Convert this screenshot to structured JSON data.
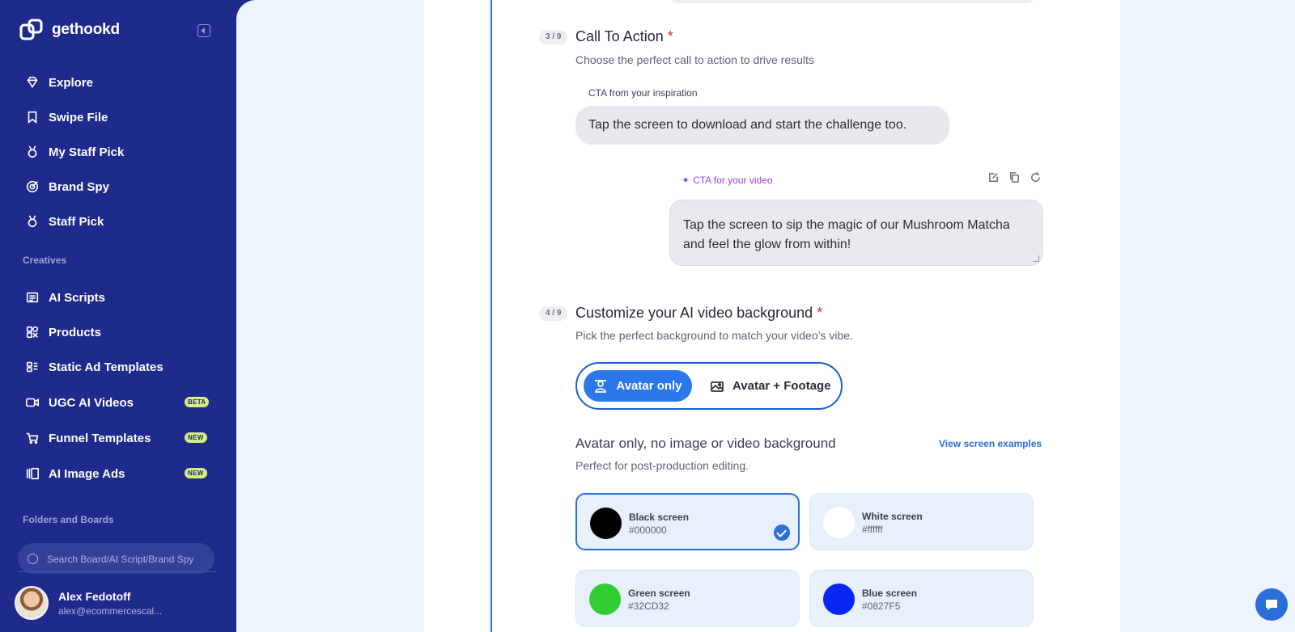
{
  "app": {
    "name": "gethookd"
  },
  "sidebar": {
    "nav_main": [
      {
        "label": "Explore",
        "icon": "diamond-icon"
      },
      {
        "label": "Swipe File",
        "icon": "bookmark-icon"
      },
      {
        "label": "My Staff Pick",
        "icon": "medal-icon"
      },
      {
        "label": "Brand Spy",
        "icon": "target-icon"
      },
      {
        "label": "Staff Pick",
        "icon": "medal-icon"
      }
    ],
    "section_creatives": "Creatives",
    "nav_creatives": [
      {
        "label": "AI Scripts",
        "icon": "script-icon"
      },
      {
        "label": "Products",
        "icon": "products-icon"
      },
      {
        "label": "Static Ad Templates",
        "icon": "template-icon"
      },
      {
        "label": "UGC AI Videos",
        "icon": "video-icon",
        "badge": "BETA"
      },
      {
        "label": "Funnel Templates",
        "icon": "cart-icon",
        "badge": "NEW"
      },
      {
        "label": "AI Image Ads",
        "icon": "gallery-icon",
        "badge": "NEW"
      }
    ],
    "section_folders": "Folders and Boards",
    "search_placeholder": "Search Board/AI Script/Brand Spy",
    "user": {
      "name": "Alex Fedotoff",
      "email": "alex@ecommercescal..."
    }
  },
  "form": {
    "step3": {
      "badge": "3 / 9",
      "title": "Call To Action",
      "required": "*",
      "subtitle": "Choose the perfect call to action to drive results",
      "inspiration_label": "CTA from your inspiration",
      "inspiration_text": "Tap the screen to download and start the challenge too.",
      "ai_label": "CTA for your video",
      "ai_text": "Tap the screen to sip the magic of our Mushroom Matcha and feel the glow from within!"
    },
    "step4": {
      "badge": "4 / 9",
      "title": "Customize your AI video background",
      "required": "*",
      "subtitle": "Pick the perfect background to match your video’s vibe.",
      "toggle_on": "Avatar only",
      "toggle_off": "Avatar + Footage",
      "option_heading": "Avatar only, no image or video background",
      "option_sub": "Perfect for post-production editing.",
      "view_examples": "View screen examples",
      "swatches": [
        {
          "name": "Black screen",
          "hex": "#000000",
          "color": "#000000",
          "selected": true
        },
        {
          "name": "White screen",
          "hex": "#ffffff",
          "color": "#ffffff",
          "selected": false
        },
        {
          "name": "Green screen",
          "hex": "#32CD32",
          "color": "#32CD32",
          "selected": false
        },
        {
          "name": "Blue screen",
          "hex": "#0827F5",
          "color": "#0827F5",
          "selected": false
        }
      ]
    }
  },
  "colors": {
    "sidebar_bg": "#1f2b8c",
    "accent": "#2a6fd8",
    "required": "#d12a2a",
    "ai_purple": "#9b3fd1"
  }
}
